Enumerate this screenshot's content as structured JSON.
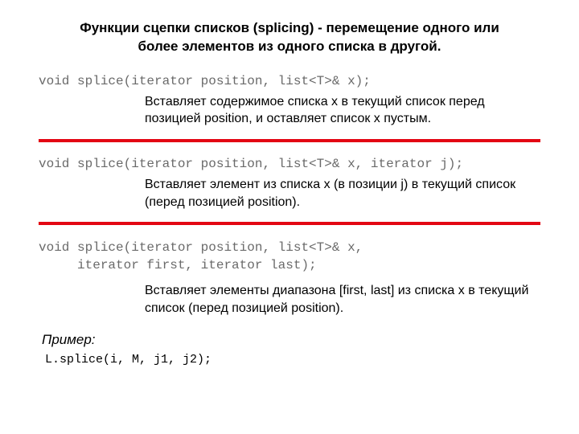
{
  "title": "Функции сцепки списков (splicing) - перемещение одного или более элементов из одного списка в другой.",
  "sections": [
    {
      "code": "void splice(iterator position, list<T>& x);",
      "desc": "Вставляет содержимое списка x в текущий список перед позицией position, и оставляет список x пустым."
    },
    {
      "code": "void splice(iterator position, list<T>& x, iterator j);",
      "desc": "Вставляет элемент из списка x (в позиции j) в текущий список (перед позицией position)."
    },
    {
      "code": "void splice(iterator position, list<T>& x,\n     iterator first, iterator last);",
      "desc": "Вставляет элементы диапазона [first, last] из списка x в текущий список (перед позицией position)."
    }
  ],
  "example": {
    "label": "Пример:",
    "code": "L.splice(i, M, j1, j2);"
  }
}
